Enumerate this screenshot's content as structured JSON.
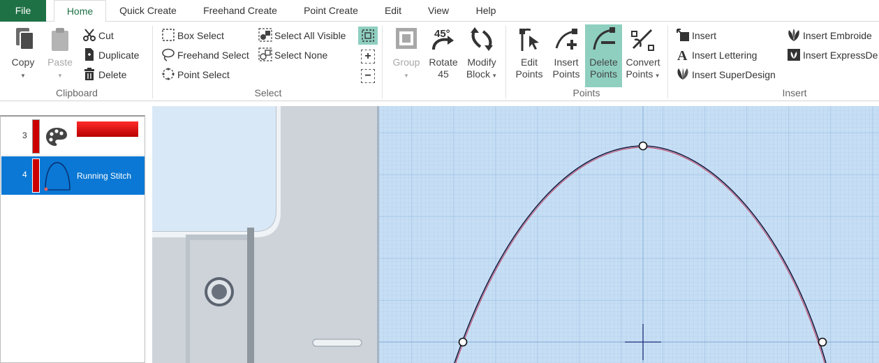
{
  "menu": {
    "file": "File",
    "tabs": [
      "Home",
      "Quick Create",
      "Freehand Create",
      "Point Create",
      "Edit",
      "View",
      "Help"
    ]
  },
  "ribbon": {
    "clipboard": {
      "label": "Clipboard",
      "copy": "Copy",
      "paste": "Paste",
      "cut": "Cut",
      "duplicate": "Duplicate",
      "delete": "Delete"
    },
    "select": {
      "label": "Select",
      "box_select": "Box Select",
      "freehand_select": "Freehand Select",
      "point_select": "Point Select",
      "select_all_visible": "Select All Visible",
      "select_none": "Select None"
    },
    "group": {
      "group": "Group",
      "rotate_l1": "Rotate",
      "rotate_l2": "45",
      "modify_l1": "Modify",
      "modify_l2": "Block"
    },
    "points": {
      "label": "Points",
      "edit_l1": "Edit",
      "edit_l2": "Points",
      "insert_l1": "Insert",
      "insert_l2": "Points",
      "delete_l1": "Delete",
      "delete_l2": "Points",
      "convert_l1": "Convert",
      "convert_l2": "Points"
    },
    "insert": {
      "label": "Insert",
      "insert": "Insert",
      "insert_lettering": "Insert Lettering",
      "insert_superdesign": "Insert SuperDesign",
      "insert_embroidery": "Insert Embroide",
      "insert_expressdesign": "Insert ExpressDe"
    }
  },
  "layers": [
    {
      "number": "3",
      "label": ""
    },
    {
      "number": "4",
      "label": "Running Stitch"
    }
  ],
  "colors": {
    "accent": "#1e7145",
    "selection": "#0a78d4",
    "active_button": "#8fcfc0",
    "thread": "#cc0000"
  }
}
